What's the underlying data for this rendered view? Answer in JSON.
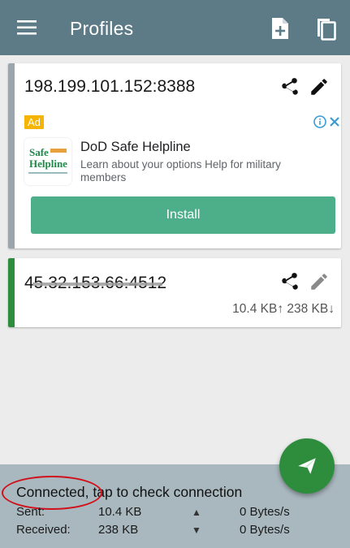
{
  "appbar": {
    "title": "Profiles",
    "icons": [
      "menu-icon",
      "import-file-icon",
      "copy-icon"
    ]
  },
  "profiles": [
    {
      "server": "198.199.101.152:8388",
      "selected": false,
      "stripe_color": "#9aa6ab",
      "icons": [
        "share-icon",
        "edit-icon"
      ]
    },
    {
      "server": "45.32.153.66:4512",
      "selected": true,
      "stripe_color": "#2e8d3d",
      "upload": "10.4 KB↑",
      "download": "238 KB↓",
      "icons": [
        "share-icon",
        "edit-icon"
      ]
    }
  ],
  "ad": {
    "badge": "Ad",
    "logo_line1": "Safe",
    "logo_line2": "Helpline",
    "headline": "DoD Safe Helpline",
    "body": "Learn about your options Help for military members",
    "cta": "Install",
    "icons": [
      "info-icon",
      "close-icon"
    ]
  },
  "fab": {
    "icon": "send-icon"
  },
  "status": {
    "message": "Connected, tap to check connection",
    "sent_label": "Sent:",
    "sent_value": "10.4 KB",
    "sent_arrow": "▲",
    "sent_rate": "0 Bytes/s",
    "received_label": "Received:",
    "received_value": "238 KB",
    "received_arrow": "▼",
    "received_rate": "0 Bytes/s"
  },
  "colors": {
    "appbar": "#5d7a87",
    "status_bar": "#a9b8bf",
    "accent_green": "#2e8d3d",
    "ad_button": "#4caf8a",
    "annotation_red": "#d0111b"
  }
}
